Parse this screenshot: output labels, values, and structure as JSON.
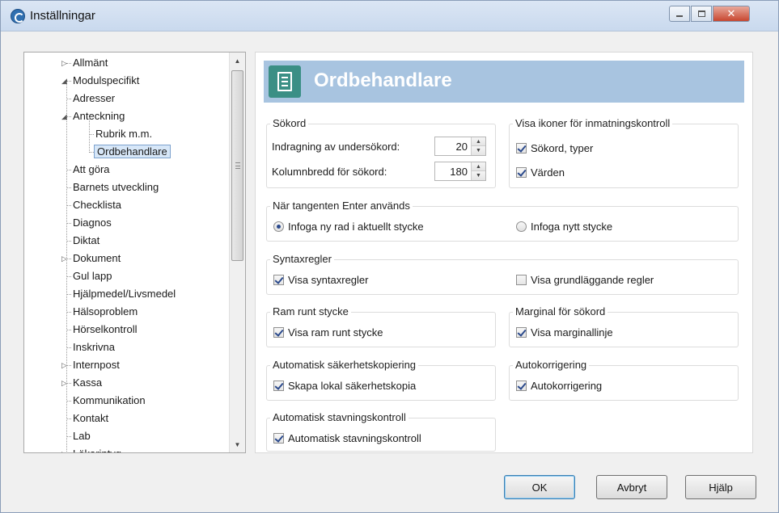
{
  "window": {
    "title": "Inställningar"
  },
  "tree": {
    "items": [
      {
        "label": "Allmänt",
        "expander": "▷"
      },
      {
        "label": "Modulspecifikt",
        "expander": "◢"
      },
      {
        "label": "Adresser"
      },
      {
        "label": "Anteckning",
        "expander": "◢"
      },
      {
        "label": "Rubrik m.m."
      },
      {
        "label": "Ordbehandlare",
        "selected": true
      },
      {
        "label": "Att göra"
      },
      {
        "label": "Barnets utveckling"
      },
      {
        "label": "Checklista"
      },
      {
        "label": "Diagnos"
      },
      {
        "label": "Diktat"
      },
      {
        "label": "Dokument",
        "expander": "▷"
      },
      {
        "label": "Gul lapp"
      },
      {
        "label": "Hjälpmedel/Livsmedel"
      },
      {
        "label": "Hälsoproblem"
      },
      {
        "label": "Hörselkontroll"
      },
      {
        "label": "Inskrivna"
      },
      {
        "label": "Internpost",
        "expander": "▷"
      },
      {
        "label": "Kassa",
        "expander": "▷"
      },
      {
        "label": "Kommunikation"
      },
      {
        "label": "Kontakt"
      },
      {
        "label": "Lab"
      },
      {
        "label": "Läkarintyg",
        "expander": "▷"
      }
    ]
  },
  "header": {
    "title": "Ordbehandlare",
    "icon": "document-icon",
    "color": "#a8c4e0",
    "icon_color": "#3b8f85"
  },
  "sokord": {
    "label": "Sökord",
    "indent_label": "Indragning av undersökord:",
    "indent_value": "20",
    "column_label": "Kolumnbredd för sökord:",
    "column_value": "180"
  },
  "visa_ikoner": {
    "label": "Visa ikoner för inmatningskontroll",
    "opt1": "Sökord, typer",
    "opt1_checked": true,
    "opt2": "Värden",
    "opt2_checked": true
  },
  "enter": {
    "label": "När tangenten Enter används",
    "opt1": "Infoga ny rad i aktuellt stycke",
    "opt1_selected": true,
    "opt2": "Infoga nytt stycke",
    "opt2_selected": false
  },
  "syntax": {
    "label": "Syntaxregler",
    "opt1": "Visa syntaxregler",
    "opt1_checked": true,
    "opt2": "Visa grundläggande regler",
    "opt2_checked": false
  },
  "ram": {
    "label": "Ram runt stycke",
    "opt1": "Visa ram runt stycke",
    "opt1_checked": true
  },
  "marginal": {
    "label": "Marginal för sökord",
    "opt1": "Visa marginallinje",
    "opt1_checked": true
  },
  "backup": {
    "label": "Automatisk säkerhetskopiering",
    "opt1": "Skapa lokal säkerhetskopia",
    "opt1_checked": true
  },
  "autokorr": {
    "label": "Autokorrigering",
    "opt1": "Autokorrigering",
    "opt1_checked": true
  },
  "stavning": {
    "label": "Automatisk stavningskontroll",
    "opt1": "Automatisk stavningskontroll",
    "opt1_checked": true
  },
  "buttons": {
    "ok": "OK",
    "cancel": "Avbryt",
    "help": "Hjälp"
  }
}
